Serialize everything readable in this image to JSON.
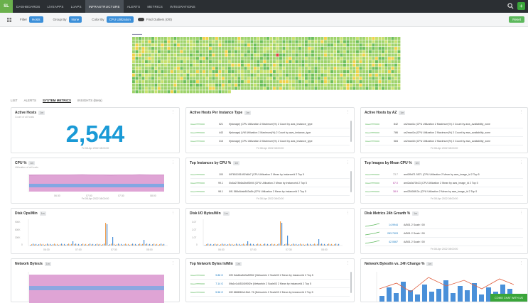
{
  "nav": {
    "logo": "SL",
    "items": [
      "DASHBOARDS",
      "LiVEAPPS",
      "LoAPS",
      "INFRASTRUCTURE",
      "ALERTS",
      "METRICS",
      "INTEGRATIONS"
    ],
    "active_index": 3
  },
  "toolbar": {
    "filter_label": "Filter",
    "filter_value": "Hosts",
    "group_label": "Group By",
    "group_value": "None",
    "color_label": "Color By",
    "color_value": "CPU Utilization",
    "outliers_label": "Find Outliers (0/0)",
    "reset_label": "Reset"
  },
  "tabs": [
    "LIST",
    "ALERTS",
    "SYSTEM METRICS",
    "INSIGHTS (Beta)"
  ],
  "active_tab": 2,
  "panels": {
    "active_hosts": {
      "title": "Active Hosts",
      "badge": "1m",
      "subtitle": "Count of all hosts",
      "value": "2,544",
      "footer": "Fri 08 Apr 2022 08:00:00"
    },
    "per_instance": {
      "title": "Active Hosts Per Instance Type",
      "badge": "1m",
      "footer": "Fri 08 Apr 2022 08:00:00",
      "rows": [
        {
          "value": "521",
          "text": "if(storage) (CPU Utilization 2 Maximum(%) 2 Count by aws_instance_type"
        },
        {
          "value": "443",
          "text": "if(storage) (VM Utilization 2 Maximum(%) 2 Count by aws_instance_type"
        },
        {
          "value": "315",
          "text": "if(storage) (CPU Utilization 2 Maximum(%) 2 Count by aws_instance_type"
        }
      ]
    },
    "by_az": {
      "title": "Active Hosts by AZ",
      "badge": "1m",
      "footer": "Fri 08 Apr 2022 08:00:00",
      "rows": [
        {
          "value": "842",
          "text": "us2east1c (CPU Utilization 2 Maximum(%) 2 Count by aws_availability_zone"
        },
        {
          "value": "786",
          "text": "us2east1a (CPU Utilization 2 Maximum(%) 2 Count by aws_availability_zone"
        },
        {
          "value": "584",
          "text": "us2east1b (CPU Utilization 2 Maximum(%) 2 Count by aws_availability_zone"
        }
      ]
    },
    "cpu": {
      "title": "CPU %",
      "badge": "1m",
      "subtitle": "Utilization of all hosts",
      "footer": "Fri 08 Apr 2022 08:00:00",
      "x_ticks": [
        "06:30",
        "07:00",
        "07:30",
        "08:00"
      ]
    },
    "top_instances": {
      "title": "Top Instances by CPU %",
      "badge": "1m",
      "footer": "Fri 08 Apr 2022 08:00:00",
      "rows": [
        {
          "value": "100",
          "text": "i0f7651051692b8b7 (CPU Utilization 2 Mean by instanceId 2 Top 5"
        },
        {
          "value": "99.1",
          "text": "i0c6a278b6a3bdf3b94 (CPU Utilization 2 Mean by instanceId 2 Top 5"
        },
        {
          "value": "98.1",
          "text": "i0f1 588c8dab843a5b (CPU Utilization 2 Mean by instanceId 2 Top 5"
        }
      ]
    },
    "top_images": {
      "title": "Top Images by Mean CPU %",
      "badge": "1m",
      "footer": "Fri 08 Apr 2022 08:00:00",
      "rows": [
        {
          "value": "73.7",
          "text": "ami0f9d71 5571 (CPU Utilization 2 Mean by aws_image_id 2 Top 5"
        },
        {
          "value": "67.0",
          "text": "ami2a0a70b13 (CPU Utilization 2 Mean by aws_image_id 2 Top 5"
        },
        {
          "value": "38.9",
          "text": "ami25408f13c (CPU Utilization 2 Mean by aws_image_id 2 Top 5"
        }
      ]
    },
    "disk_ops": {
      "title": "Disk Ops/Min",
      "badge": "1m",
      "footer": "Fri 08 Apr 2022 08:00:00",
      "y_ticks": [
        "900K",
        "600K",
        "300K",
        "0"
      ],
      "x_ticks": [
        "06:30",
        "07:00",
        "07:30",
        "08:00"
      ]
    },
    "disk_io": {
      "title": "Disk I/O Bytes/Min",
      "badge": "1m",
      "footer": "Fri 08 Apr 2022 08:00:00",
      "y_ticks": [
        "3.0T",
        "2.0T",
        "1.0T",
        "0"
      ],
      "x_ticks": [
        "06:30",
        "07:00",
        "07:30",
        "08:00"
      ]
    },
    "disk_growth": {
      "title": "Disk Metrics 24h Growth %",
      "badge": "1m",
      "footer": "Fri 08 Apr 2022 08:00:00",
      "rows": [
        {
          "value": "14.9944",
          "text": "A/B01 2 Scale I 00"
        },
        {
          "value": "283.7903",
          "text": "A/B01 2 Scale I 00"
        },
        {
          "value": "42.0667",
          "text": "A/B01 2 Scale I 00"
        }
      ]
    },
    "net_bytes": {
      "title": "Network Bytes/s",
      "badge": "1m"
    },
    "top_net": {
      "title": "Top Network Bytes In/Min",
      "badge": "1m",
      "rows": [
        {
          "value": "9.88 G",
          "text": "i0f9 5da6ba5d3a5f952 (Networkin 2 Scale03 2 Mean by instanceId 2 Top 5"
        },
        {
          "value": "7.14 G",
          "text": "i0fa1e1d4534090f2e (Networkin 2 Scale03 2 Mean by instanceId 2 Top 5"
        },
        {
          "value": "5.58 G",
          "text": "i0f2 8886f60c1f6e1 76 (Networkin 2 Scale03 2 Mean by instanceId 2 Top 5"
        }
      ]
    },
    "net_change": {
      "title": "Network Bytes/In vs. 24h Change %",
      "badge": "1m"
    }
  },
  "chat_label": "COMO CHAT WITH US",
  "colors": {
    "accent": "#1a9ad6",
    "pink": "#d98fc9",
    "blue": "#4a90d9",
    "orange": "#f0a050",
    "green": "#5cb85c"
  }
}
